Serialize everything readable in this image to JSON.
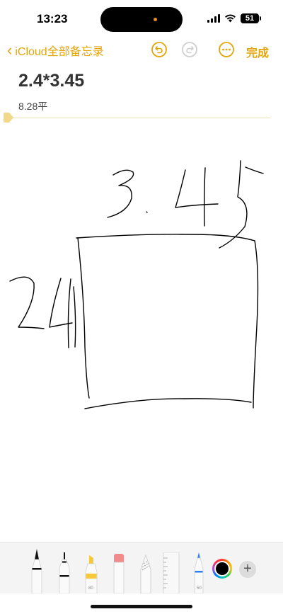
{
  "status": {
    "time": "13:23",
    "battery": "51"
  },
  "nav": {
    "back_label": "iCloud全部备忘录",
    "done_label": "完成"
  },
  "note": {
    "title": "2.4*3.45",
    "subtitle": "8.28平"
  },
  "toolbar": {
    "tools": [
      "pen",
      "fineliner",
      "marker",
      "eraser",
      "lasso",
      "ruler",
      "pencil"
    ],
    "marker_width": "80",
    "pencil_width": "50",
    "selected_color": "#000000"
  },
  "colors": {
    "accent": "#e2a60a",
    "ink": "#000000"
  }
}
